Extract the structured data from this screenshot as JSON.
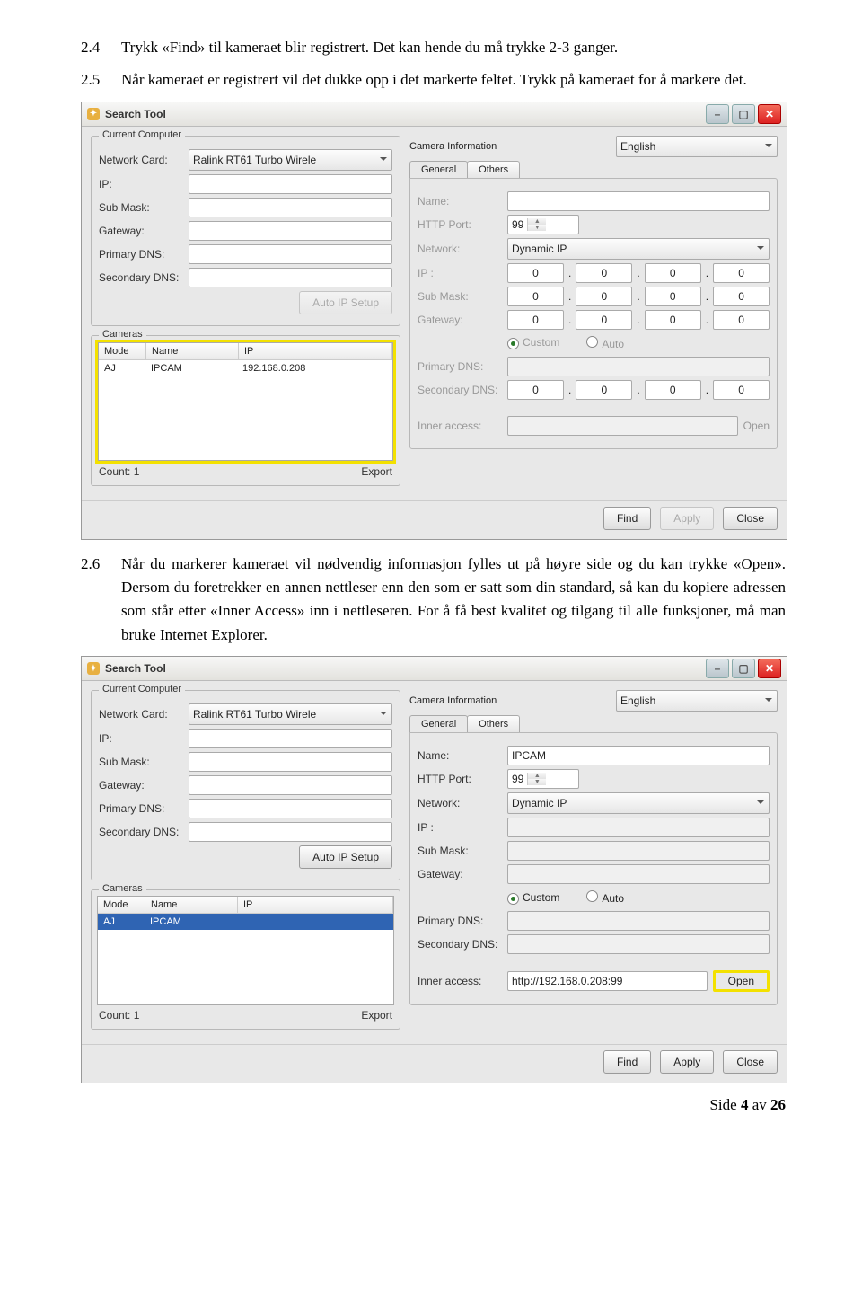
{
  "para1": {
    "num": "2.4",
    "text": "Trykk «Find» til kameraet blir registrert. Det kan hende du må trykke 2-3 ganger."
  },
  "para2": {
    "num": "2.5",
    "text": "Når kameraet er registrert vil det dukke opp i det markerte feltet. Trykk på kameraet for å markere det."
  },
  "para3": {
    "num": "2.6",
    "text": "Når du markerer kameraet vil nødvendig informasjon fylles ut på høyre side og du kan trykke «Open». Dersom du foretrekker en annen nettleser enn den som er satt som din standard, så kan du kopiere adressen som står etter «Inner Access» inn i nettleseren. For å få best kvalitet og tilgang til alle funksjoner, må man bruke Internet Explorer."
  },
  "app": {
    "title": "Search Tool",
    "lang": "English",
    "cc_title": "Current Computer",
    "ci_title": "Camera Information",
    "cam_title": "Cameras",
    "labels": {
      "networkcard": "Network Card:",
      "ip": "IP:",
      "submask": "Sub Mask:",
      "gateway": "Gateway:",
      "pdns": "Primary DNS:",
      "sdns": "Secondary DNS:",
      "autoip": "Auto IP Setup",
      "name": "Name:",
      "http": "HTTP Port:",
      "network": "Network:",
      "ipr": "IP :",
      "submaskr": "Sub Mask:",
      "gatewayr": "Gateway:",
      "custom": "Custom",
      "auto": "Auto",
      "inner": "Inner access:",
      "open": "Open",
      "count": "Count: 1",
      "export": "Export",
      "find": "Find",
      "apply": "Apply",
      "close": "Close",
      "general": "General",
      "others": "Others",
      "mode": "Mode",
      "cname": "Name",
      "cip": "IP"
    },
    "nc_value": "Ralink RT61 Turbo Wirele"
  },
  "s1": {
    "cam": {
      "mode": "AJ",
      "name": "IPCAM",
      "ip": "192.168.0.208"
    },
    "http": "99",
    "network": "Dynamic IP",
    "ip": [
      "0",
      "0",
      "0",
      "0"
    ],
    "sub": [
      "0",
      "0",
      "0",
      "0"
    ],
    "gw": [
      "0",
      "0",
      "0",
      "0"
    ],
    "sdns": [
      "0",
      "0",
      "0",
      "0"
    ],
    "name_val": ""
  },
  "s2": {
    "cam": {
      "mode": "AJ",
      "name": "IPCAM",
      "ip": ""
    },
    "http": "99",
    "network": "Dynamic IP",
    "name_val": "IPCAM",
    "inner": "http://192.168.0.208:99"
  },
  "footer": {
    "pre": "Side ",
    "p": "4",
    "mid": " av ",
    "t": "26"
  }
}
